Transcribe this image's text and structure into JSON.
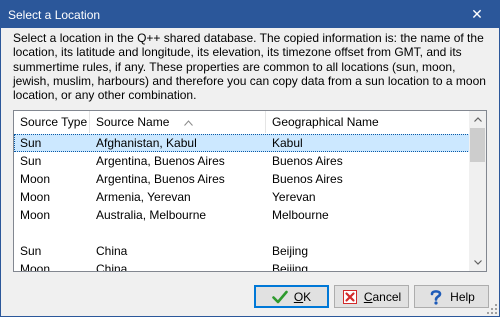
{
  "window": {
    "title": "Select a Location",
    "close_glyph": "✕"
  },
  "description": "Select a location in the Q++ shared database. The copied information is: the name of the location, its latitude and longitude, its elevation, its timezone offset from GMT, and its summertime rules, if any. These properties are common to all locations (sun, moon, jewish, muslim, harbours) and therefore you can copy data from a sun location to a moon location, or any other combination.",
  "list": {
    "columns": [
      "Source Type",
      "Source Name",
      "Geographical Name"
    ],
    "sorted_column": "Source Name",
    "rows": [
      {
        "type": "Sun",
        "name": "Afghanistan, Kabul",
        "geo": "Kabul",
        "selected": true
      },
      {
        "type": "Sun",
        "name": "Argentina, Buenos Aires",
        "geo": "Buenos Aires"
      },
      {
        "type": "Moon",
        "name": "Argentina, Buenos Aires",
        "geo": "Buenos Aires"
      },
      {
        "type": "Moon",
        "name": "Armenia, Yerevan",
        "geo": "Yerevan"
      },
      {
        "type": "Moon",
        "name": "Australia, Melbourne",
        "geo": "Melbourne"
      },
      {
        "type": "",
        "name": "",
        "geo": "",
        "faded": true
      },
      {
        "type": "Sun",
        "name": "China",
        "geo": "Beijing"
      },
      {
        "type": "Moon",
        "name": "China",
        "geo": "Beijing"
      }
    ]
  },
  "buttons": {
    "ok": {
      "prefix": "",
      "accel": "O",
      "suffix": "K"
    },
    "cancel": {
      "prefix": "",
      "accel": "C",
      "suffix": "ancel"
    },
    "help": {
      "label": "Help"
    }
  },
  "icons": {
    "ok": "check-icon",
    "cancel": "x-icon",
    "help": "question-icon"
  },
  "colors": {
    "titlebar": "#2b579a",
    "selection": "#cce8ff",
    "ok_check": "#2e9a2e",
    "cancel_x": "#d22b2b",
    "help_q": "#1e5bb8"
  }
}
